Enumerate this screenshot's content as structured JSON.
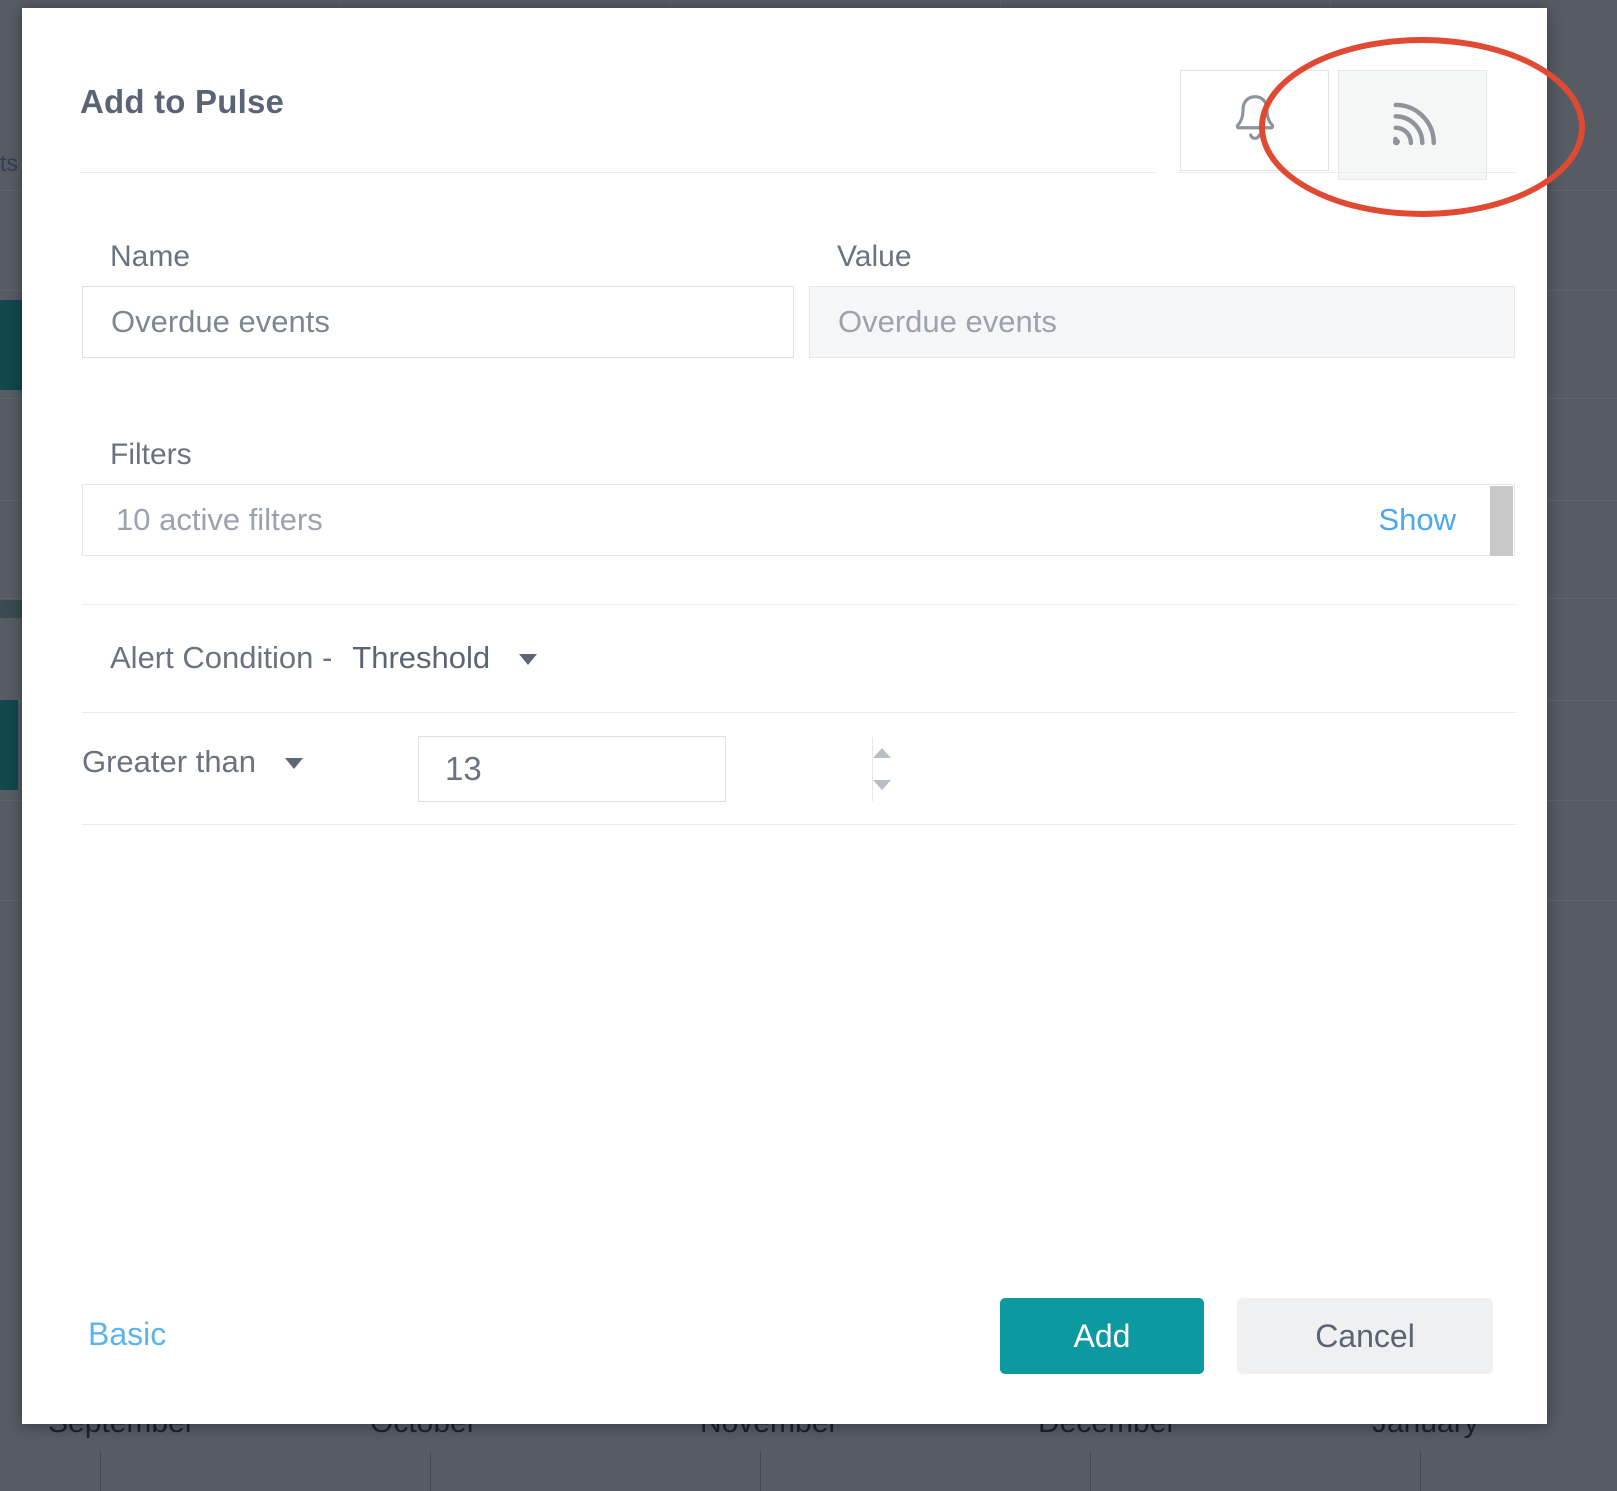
{
  "background": {
    "left_text_fragment": "ts",
    "months": [
      "September",
      "October",
      "November",
      "December",
      "January"
    ]
  },
  "dialog": {
    "title": "Add to Pulse",
    "tabs": [
      {
        "name": "alert-tab",
        "icon": "bell-icon",
        "selected": false
      },
      {
        "name": "pulse-tab",
        "icon": "rss-icon",
        "selected": true
      }
    ],
    "fields": {
      "name": {
        "label": "Name",
        "value": "Overdue events",
        "placeholder": "Overdue events"
      },
      "value": {
        "label": "Value",
        "value": "Overdue events",
        "placeholder": "Overdue events",
        "disabled": true
      },
      "filters": {
        "label": "Filters",
        "summary": "10 active filters",
        "show_link": "Show"
      }
    },
    "alert_condition": {
      "label": "Alert Condition -",
      "type": "Threshold",
      "operator": "Greater than",
      "threshold": "13"
    },
    "footer": {
      "basic_link": "Basic",
      "add_label": "Add",
      "cancel_label": "Cancel"
    },
    "colors": {
      "accent_teal": "#0c9aa0",
      "link_blue": "#5cb3f0",
      "annotation_red": "#e04a32",
      "text_slate": "#5b6475"
    }
  }
}
